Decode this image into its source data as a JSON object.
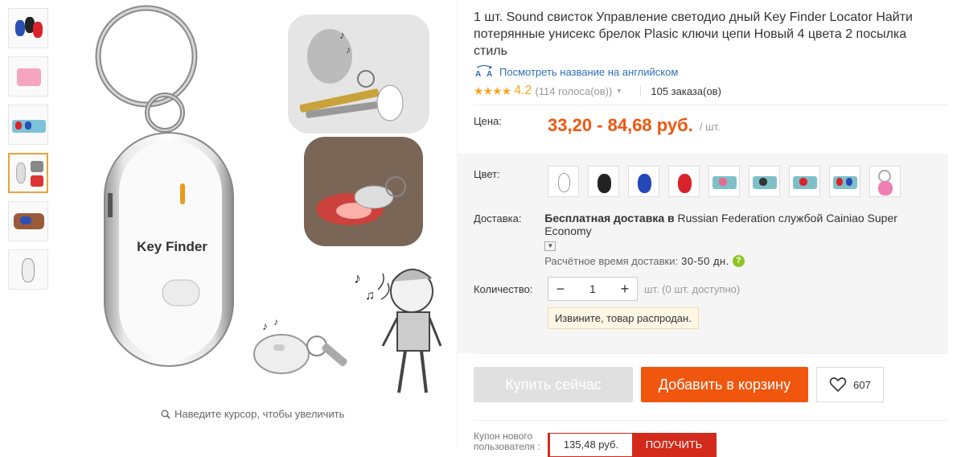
{
  "product": {
    "title": "1 шт. Sound свисток Управление светодио дный Key Finder Locator Найти потерянные унисекс брелок Plasic ключи цепи Новый 4 цвета 2 посылка стиль",
    "translate_link": "Посмотреть название на английском",
    "rating": "4.2",
    "stars": "★★★★",
    "votes": "(114 голоса(ов))",
    "orders": "105 заказа(ов)",
    "device_label": "Key Finder"
  },
  "gallery": {
    "zoom_hint": "Наведите курсор, чтобы увеличить"
  },
  "price": {
    "label": "Цена:",
    "value": "33,20 - 84,68 руб.",
    "unit": "/ шт."
  },
  "color": {
    "label": "Цвет:",
    "swatches": [
      "white",
      "black",
      "blue",
      "red",
      "pink-pack",
      "pink-pack-2",
      "pink-pack-3",
      "mixed-pack",
      "pink-2pack"
    ]
  },
  "shipping": {
    "label": "Доставка:",
    "prefix": "Бесплатная доставка в",
    "country": "Russian Federation",
    "service_prefix": "службой",
    "service": "Cainiao Super Economy",
    "time_label": "Расчётное время доставки:",
    "time_value": "30-50 дн."
  },
  "quantity": {
    "label": "Количество:",
    "value": "1",
    "minus": "−",
    "plus": "+",
    "note": "шт. (0 шт. доступно)",
    "sold_out": "Извините, товар распродан."
  },
  "actions": {
    "buy_now": "Купить сейчас",
    "add_to_cart": "Добавить в корзину",
    "wishlist_count": "607"
  },
  "coupon": {
    "label": "Купон нового пользователя :",
    "amount": "135,48 руб.",
    "get": "ПОЛУЧИТЬ"
  },
  "colors": {
    "accent": "#f0560e",
    "coupon_red": "#d42a1b",
    "link": "#2f6fb3",
    "star": "#f5a623"
  }
}
